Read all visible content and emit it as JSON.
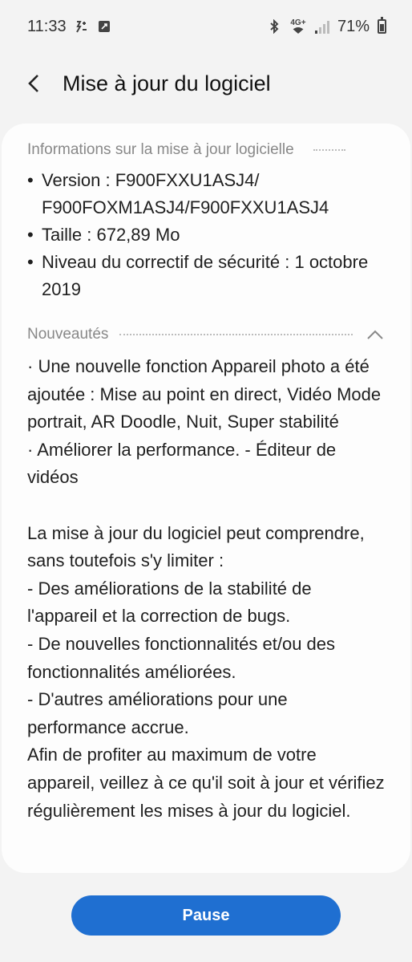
{
  "status_bar": {
    "time": "11:33",
    "network_type": "4G+",
    "battery_percent": "71%",
    "icons": [
      "data-saver-icon",
      "screenshot-icon",
      "bluetooth-icon",
      "wifi-icon",
      "signal-icon",
      "battery-icon"
    ]
  },
  "header": {
    "title": "Mise à jour du logiciel"
  },
  "info": {
    "heading": "Informations sur la mise à jour logicielle",
    "items": [
      "Version : F900FXXU1ASJ4/ F900FOXM1ASJ4/F900FXXU1ASJ4",
      "Taille : 672,89 Mo",
      "Niveau du correctif de sécurité : 1 octobre 2019"
    ]
  },
  "news": {
    "heading": "Nouveautés",
    "body": "· Une nouvelle fonction Appareil photo a été ajoutée : Mise au point en direct, Vidéo Mode portrait, AR Doodle, Nuit, Super stabilité\n· Améliorer la performance. - Éditeur de vidéos\n\nLa mise à jour du logiciel peut comprendre, sans toutefois s'y limiter :\n - Des améliorations de la stabilité de l'appareil et la correction de bugs.\n - De nouvelles fonctionnalités et/ou des fonctionnalités améliorées.\n - D'autres améliorations pour une performance accrue.\nAfin de profiter au maximum de votre appareil, veillez à ce qu'il soit à jour et vérifiez régulièrement les mises à jour du logiciel."
  },
  "actions": {
    "pause_label": "Pause"
  },
  "colors": {
    "accent": "#1f6fd1",
    "background": "#f3f3f3",
    "card": "#fdfdfd"
  }
}
